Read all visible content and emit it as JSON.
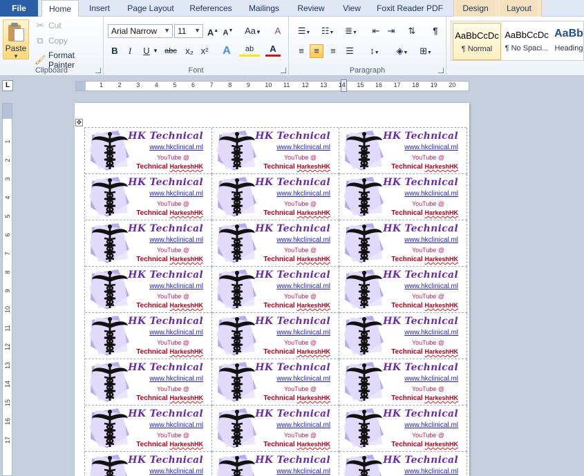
{
  "tabs": {
    "file": "File",
    "home": "Home",
    "insert": "Insert",
    "page_layout": "Page Layout",
    "references": "References",
    "mailings": "Mailings",
    "review": "Review",
    "view": "View",
    "foxit": "Foxit Reader PDF",
    "design": "Design",
    "layout": "Layout"
  },
  "clipboard": {
    "paste": "Paste",
    "cut": "Cut",
    "copy": "Copy",
    "format_painter": "Format Painter",
    "group_label": "Clipboard"
  },
  "font": {
    "name": "Arial Narrow",
    "size": "11",
    "group_label": "Font",
    "bold": "B",
    "italic": "I",
    "underline": "U",
    "strike": "abc",
    "sub": "x₂",
    "sup": "x²",
    "grow": "A",
    "shrink": "A",
    "case": "Aa",
    "clear": "A",
    "effects": "A",
    "highlight": "ab",
    "color": "A"
  },
  "paragraph": {
    "group_label": "Paragraph"
  },
  "styles": [
    {
      "preview": "AaBbCcDc",
      "name": "¶ Normal"
    },
    {
      "preview": "AaBbCcDc",
      "name": "¶ No Spaci..."
    },
    {
      "preview": "AaBb",
      "name": "Heading"
    }
  ],
  "ruler": {
    "corner": "L",
    "h_marks": [
      "1",
      "2",
      "3",
      "4",
      "5",
      "6",
      "7",
      "8",
      "9",
      "10",
      "11",
      "12",
      "13",
      "14",
      "15",
      "16",
      "17",
      "18",
      "19",
      "20"
    ],
    "v_marks": [
      "1",
      "2",
      "3",
      "4",
      "5",
      "6",
      "7",
      "8",
      "9",
      "10",
      "11",
      "12",
      "13",
      "14",
      "15",
      "16",
      "17"
    ]
  },
  "label": {
    "title": "HK Technical",
    "url": "www.hkclinical.ml",
    "youtube": "YouTube @",
    "tech": "Technical",
    "handle": "HarkeshHK"
  },
  "colors": {
    "title": "#6a2ca8",
    "url": "#2222cc",
    "youtube": "#c2185b",
    "tech": "#b3001b",
    "art_tint": "#a99bea"
  }
}
